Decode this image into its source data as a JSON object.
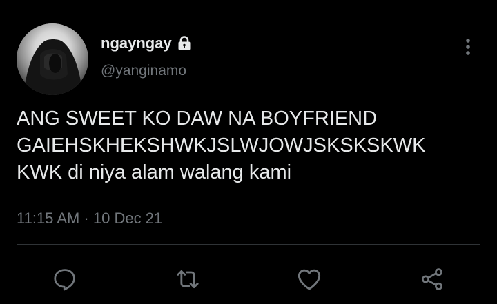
{
  "tweet": {
    "author": {
      "display_name": "ngayngay",
      "handle": "@yanginamo",
      "protected_icon": "lock-icon",
      "avatar_icon": "profile-photo"
    },
    "text_lines": [
      "ANG SWEET KO DAW NA BOYFRIEND",
      "GAIEHSKHEKSHWKJSLWJOWJSKSKSKWK",
      "KWK di niya alam walang kami"
    ],
    "timestamp": "11:15 AM · 10 Dec 21",
    "more_icon": "more-vertical-icon",
    "actions": [
      {
        "icon": "reply-icon"
      },
      {
        "icon": "retweet-icon"
      },
      {
        "icon": "like-icon"
      },
      {
        "icon": "share-icon"
      }
    ],
    "colors": {
      "background": "#000000",
      "primary_text": "#e7e9ea",
      "secondary_text": "#71767b",
      "divider": "#2f3336",
      "icon": "#71767b"
    }
  }
}
